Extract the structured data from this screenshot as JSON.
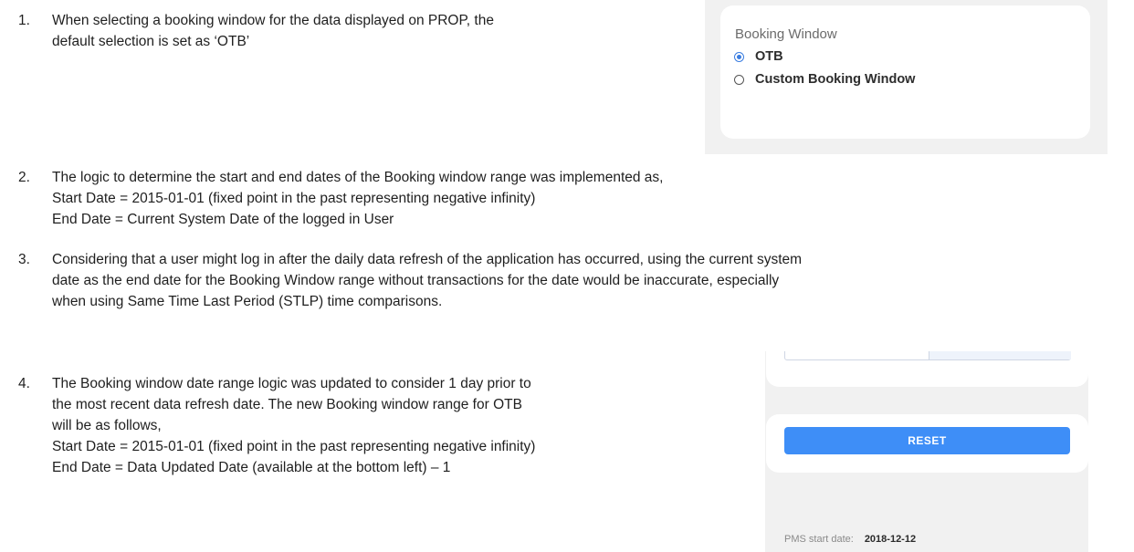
{
  "items": [
    {
      "number": "1.",
      "lines": [
        "When selecting a booking window for the data displayed on PROP, the",
        "default selection is set as ‘OTB’"
      ]
    },
    {
      "number": "2.",
      "lines": [
        "The logic to determine the start and end dates of the Booking window range was implemented as,",
        "Start Date = 2015-01-01 (fixed point in the past representing negative infinity)",
        "End Date = Current System Date of the logged in User"
      ]
    },
    {
      "number": "3.",
      "lines": [
        "Considering that a user might log in after the daily data refresh of the application has occurred, using the current system",
        "date as the end date for the Booking Window range without transactions for the date would be inaccurate, especially",
        "when using Same Time Last Period (STLP) time comparisons."
      ]
    },
    {
      "number": "4.",
      "lines": [
        "The Booking window date range logic was updated to consider 1 day prior to",
        "the most recent data refresh date. The new Booking window range for OTB",
        "will be as follows,",
        "Start Date = 2015-01-01 (fixed point in the past representing negative infinity)",
        "End Date = Data Updated Date (available at the bottom left) – 1"
      ]
    }
  ],
  "booking_window": {
    "title": "Booking Window",
    "options": [
      {
        "label": "OTB",
        "selected": true
      },
      {
        "label": "Custom Booking Window",
        "selected": false
      }
    ],
    "accent_color": "#3a7de0"
  },
  "reset_panel": {
    "reset_label": "RESET",
    "button_color": "#3e8ef7",
    "pms_start_label": "PMS start date:",
    "pms_start_value": "2018-12-12"
  }
}
